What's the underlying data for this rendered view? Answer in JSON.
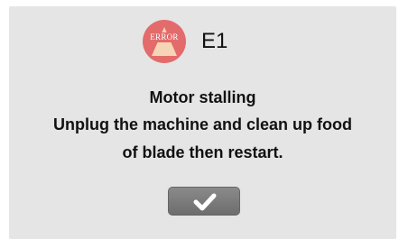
{
  "dialog": {
    "badge_text": "ERROR",
    "error_code": "E1",
    "title": "Motor stalling",
    "message_line_1": "Unplug the machine and clean up food",
    "message_line_2": "of blade then restart.",
    "confirm_icon": "checkmark-icon"
  },
  "colors": {
    "dialog_background": "#e5e5e5",
    "error_badge": "#e36b6b",
    "warning_triangle": "#f6d5b6",
    "button": "#7a7a7a"
  }
}
